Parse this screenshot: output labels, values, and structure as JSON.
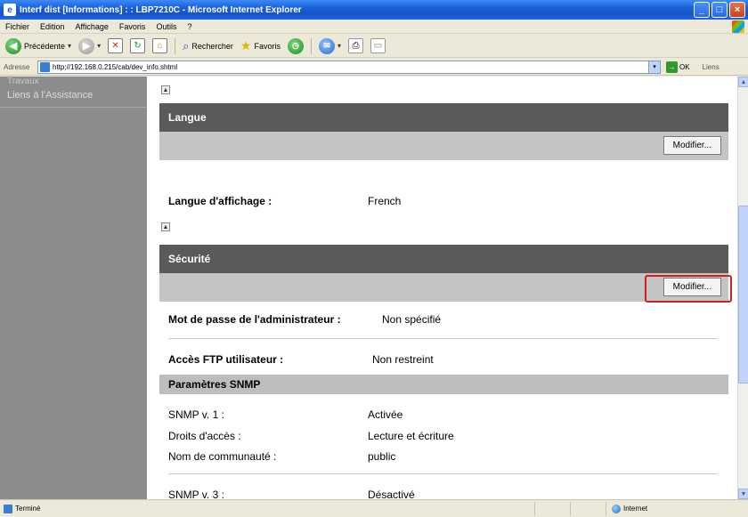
{
  "window": {
    "title": "Interf dist [Informations] : : LBP7210C - Microsoft Internet Explorer",
    "controls": {
      "minimize": "_",
      "maximize": "□",
      "close": "×"
    }
  },
  "menu": {
    "items": [
      "Fichier",
      "Edition",
      "Affichage",
      "Favoris",
      "Outils",
      "?"
    ]
  },
  "toolbar": {
    "back_label": "Précédente",
    "search_label": "Rechercher",
    "favorites_label": "Favoris",
    "icons": [
      "back-icon",
      "forward-icon",
      "stop-icon",
      "refresh-icon",
      "home-icon",
      "search-icon",
      "favorites-icon",
      "history-icon",
      "mail-icon",
      "print-icon",
      "edit-icon"
    ]
  },
  "address": {
    "label": "Adresse",
    "url": "http://192.168.0.215/cab/dev_info.shtml",
    "go_label": "OK",
    "links_label": "Liens"
  },
  "nav": {
    "partial_item": "Travaux",
    "items": [
      {
        "label": "Liens à l'Assistance"
      }
    ]
  },
  "sections": {
    "langue": {
      "title": "Langue",
      "modify_label": "Modifier...",
      "rows": [
        {
          "label": "Langue d'affichage :",
          "value": "French"
        }
      ]
    },
    "securite": {
      "title": "Sécurité",
      "modify_label": "Modifier...",
      "rows": [
        {
          "label": "Mot de passe de l'administrateur :",
          "value": "Non spécifié"
        },
        {
          "label": "Accès FTP utilisateur :",
          "value": "Non restreint"
        }
      ],
      "snmp_header": "Paramètres SNMP",
      "snmp_rows": [
        {
          "label": "SNMP v. 1 :",
          "value": "Activée"
        },
        {
          "label": "Droits d'accès :",
          "value": "Lecture et écriture"
        },
        {
          "label": "Nom de communauté :",
          "value": "public"
        },
        {
          "label": "SNMP v. 3 :",
          "value": "Désactivé"
        }
      ]
    }
  },
  "status": {
    "text": "Terminé",
    "zone": "Internet"
  },
  "colors": {
    "highlight": "#d21f1f",
    "section_header": "#5a5a5a",
    "section_bar": "#c4c4c4",
    "nav_bg": "#8c8c8c"
  }
}
